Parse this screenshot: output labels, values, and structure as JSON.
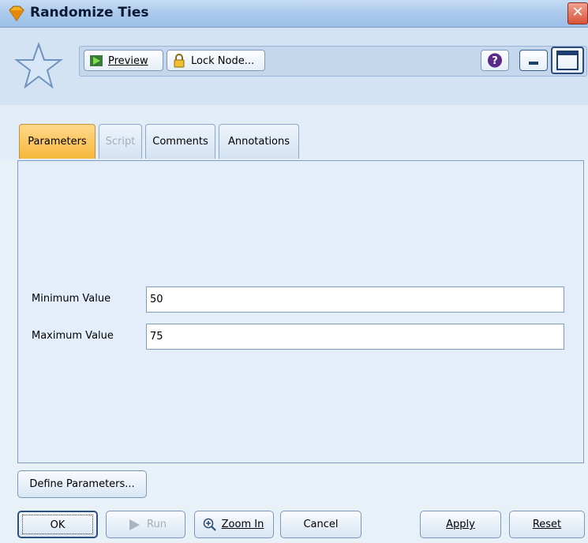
{
  "window": {
    "title": "Randomize Ties",
    "close_label": "✕"
  },
  "toolbar": {
    "preview_label": "Preview",
    "lock_label": "Lock Node..."
  },
  "tabs": [
    {
      "label": "Parameters",
      "active": true
    },
    {
      "label": "Script",
      "disabled": true
    },
    {
      "label": "Comments"
    },
    {
      "label": "Annotations"
    }
  ],
  "form": {
    "min_label": "Minimum Value",
    "min_value": "50",
    "max_label": "Maximum Value",
    "max_value": "75"
  },
  "buttons": {
    "define": "Define Parameters...",
    "ok": "OK",
    "run": "Run",
    "zoom": "Zoom In",
    "cancel": "Cancel",
    "apply": "Apply",
    "reset": "Reset"
  },
  "colors": {
    "active_tab": "#f6b73c",
    "panel_bg": "#e4eefa",
    "title_bar": "#a9c8ec"
  }
}
